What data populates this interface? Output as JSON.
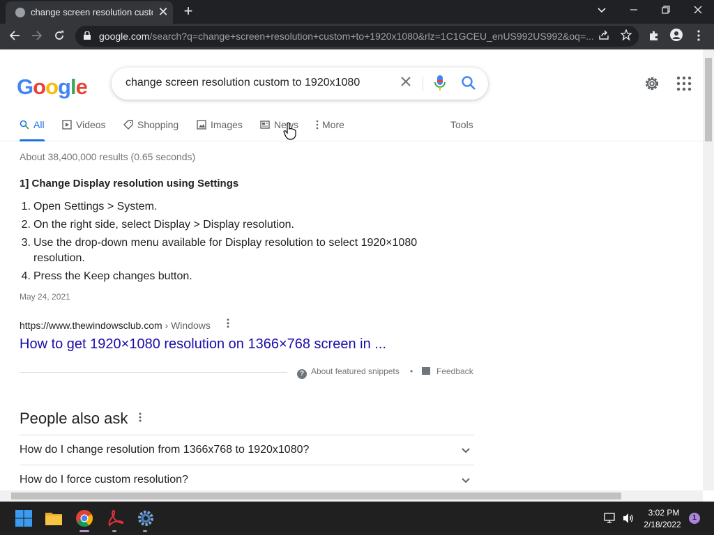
{
  "browser": {
    "tab_title": "change screen resolution custom to 1920x1080",
    "tab_close": "✕",
    "new_tab": "+",
    "url_host": "google.com",
    "url_rest": "/search?q=change+screen+resolution+custom+to+1920x1080&rlz=1C1GCEU_enUS992US992&oq=...",
    "icons": [
      "favicon-icon",
      "close-icon",
      "plus-icon",
      "minimize-icon",
      "restore-icon",
      "back-icon",
      "forward-icon",
      "reload-icon",
      "lock-icon",
      "share-icon",
      "star-icon",
      "extensions-icon",
      "profile-icon",
      "menu-icon"
    ]
  },
  "search": {
    "logo": "Google",
    "query": "change screen resolution custom to 1920x1080",
    "tabs": [
      {
        "label": "All"
      },
      {
        "label": "Videos"
      },
      {
        "label": "Shopping"
      },
      {
        "label": "Images"
      },
      {
        "label": "News"
      },
      {
        "label": "More"
      }
    ],
    "tools_label": "Tools",
    "stats": "About 38,400,000 results (0.65 seconds)"
  },
  "snippet": {
    "heading": "1] Change Display resolution using Settings",
    "steps": [
      {
        "num": "1.",
        "text": "Open Settings > System."
      },
      {
        "num": "2.",
        "text": "On the right side, select Display > Display resolution."
      },
      {
        "num": "3.",
        "text": "Use the drop-down menu available for Display resolution to select 1920×1080 resolution."
      },
      {
        "num": "4.",
        "text": "Press the Keep changes button."
      }
    ],
    "date": "May 24, 2021",
    "cite_url": "https://www.thewindowsclub.com",
    "cite_crumb": " › Windows",
    "link_title": "How to get 1920×1080 resolution on 1366×768 screen in ...",
    "about_label": "About featured snippets",
    "separator_dot": "•",
    "feedback_label": "Feedback"
  },
  "people_also_ask": {
    "title": "People also ask",
    "questions": [
      "How do I change resolution from 1366x768 to 1920x1080?",
      "How do I force custom resolution?"
    ]
  },
  "taskbar": {
    "time": "3:02 PM",
    "date": "2/18/2022",
    "notifications": "1"
  },
  "colors": {
    "google_blue": "#4285f4",
    "google_red": "#ea4335",
    "google_yellow": "#fbbc05",
    "google_green": "#34a853",
    "link": "#1a0dab",
    "active_tab": "#1a73e8"
  }
}
